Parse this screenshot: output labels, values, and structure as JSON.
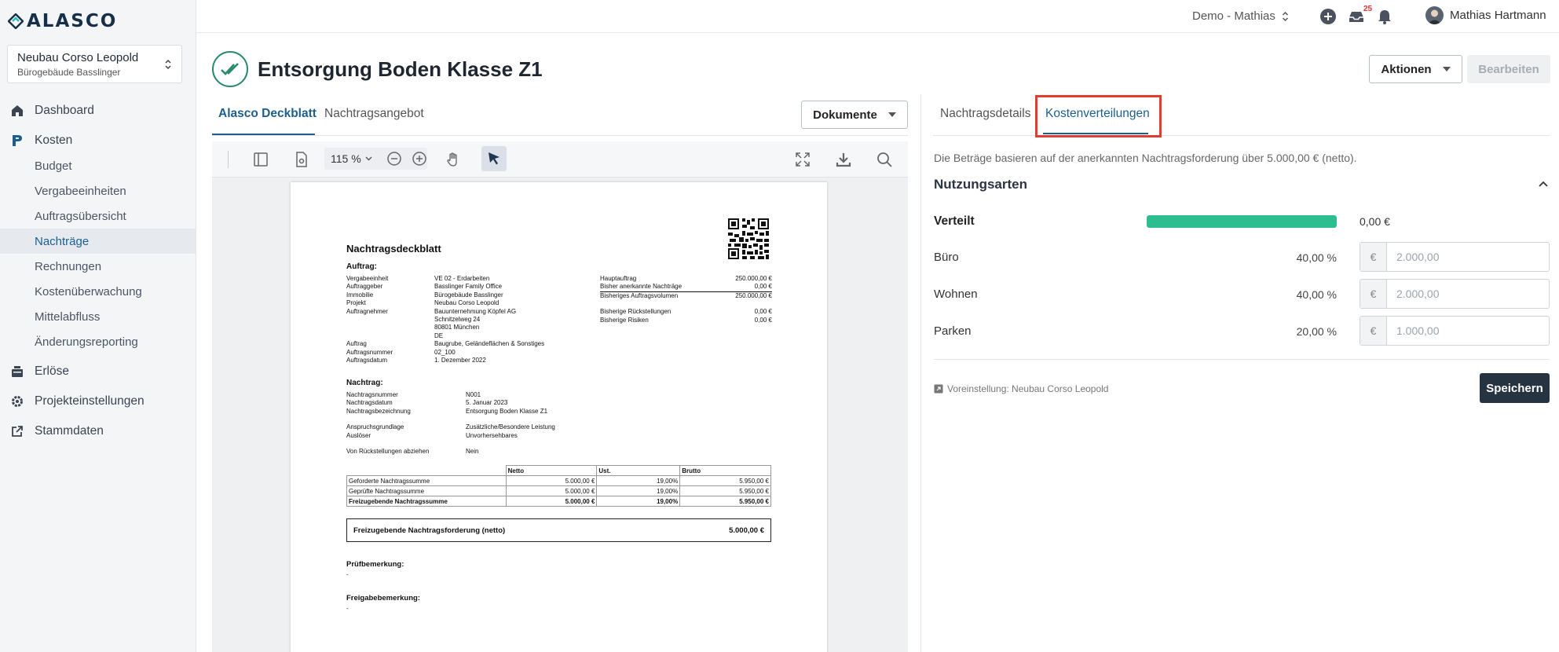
{
  "brand": {
    "name": "ALASCO"
  },
  "project": {
    "name": "Neubau Corso Leopold",
    "building": "Bürogebäude Basslinger"
  },
  "sidebar": {
    "items": [
      {
        "label": "Dashboard"
      },
      {
        "label": "Kosten"
      },
      {
        "label": "Budget"
      },
      {
        "label": "Vergabeeinheiten"
      },
      {
        "label": "Auftragsübersicht"
      },
      {
        "label": "Nachträge"
      },
      {
        "label": "Rechnungen"
      },
      {
        "label": "Kostenüberwachung"
      },
      {
        "label": "Mittelabfluss"
      },
      {
        "label": "Änderungsreporting"
      },
      {
        "label": "Erlöse"
      },
      {
        "label": "Projekteinstellungen"
      },
      {
        "label": "Stammdaten"
      }
    ]
  },
  "topbar": {
    "workspace": "Demo - Mathias",
    "inbox_count": "25",
    "user_name": "Mathias Hartmann"
  },
  "page": {
    "title": "Entsorgung Boden Klasse Z1",
    "actions_label": "Aktionen",
    "edit_label": "Bearbeiten"
  },
  "left_tabs": {
    "tab1": "Alasco Deckblatt",
    "tab2": "Nachtragsangebot",
    "documents_label": "Dokumente"
  },
  "pdf_toolbar": {
    "zoom": "115 %"
  },
  "doc": {
    "title": "Nachtragsdeckblatt",
    "auftrag_heading": "Auftrag:",
    "auftrag": [
      {
        "k": "Vergabeeinheit",
        "v": "VE 02 - Erdarbeiten"
      },
      {
        "k": "Auftraggeber",
        "v": "Basslinger Family Office"
      },
      {
        "k": "Immobilie",
        "v": "Bürogebäude Basslinger"
      },
      {
        "k": "Projekt",
        "v": "Neubau Corso Leopold"
      },
      {
        "k": "Auftragnehmer",
        "v": "Bauunternehmung Köpfel AG"
      },
      {
        "k": "",
        "v": "Schnitzelweg 24"
      },
      {
        "k": "",
        "v": "80801 München"
      },
      {
        "k": "",
        "v": "DE"
      },
      {
        "k": "Auftrag",
        "v": "Baugrube, Geländeflächen & Sonstiges"
      },
      {
        "k": "Auftragsnummer",
        "v": "02_100"
      },
      {
        "k": "Auftragsdatum",
        "v": "1. Dezember 2022"
      }
    ],
    "right_kv": [
      {
        "k": "Hauptauftrag",
        "v": "250.000,00 €"
      },
      {
        "k": "Bisher anerkannte Nachträge",
        "v": "0,00 €"
      },
      {
        "k": "Bisheriges Auftragsvolumen",
        "v": "250.000,00 €"
      },
      {
        "k": "Bisherige Rückstellungen",
        "v": "0,00 €"
      },
      {
        "k": "Bisherige Risiken",
        "v": "0,00 €"
      }
    ],
    "nachtrag_heading": "Nachtrag:",
    "nachtrag": [
      {
        "k": "Nachtragsnummer",
        "v": "N001"
      },
      {
        "k": "Nachtragsdatum",
        "v": "5. Januar 2023"
      },
      {
        "k": "Nachtragsbezeichnung",
        "v": "Entsorgung Boden Klasse Z1"
      },
      {
        "k": "Anspruchsgrundlage",
        "v": "Zusätzliche/Besondere Leistung"
      },
      {
        "k": "Auslöser",
        "v": "Unvorhersehbares"
      },
      {
        "k": "Von Rückstellungen abziehen",
        "v": "Nein"
      }
    ],
    "table": {
      "headers": [
        "Netto",
        "Ust.",
        "Brutto"
      ],
      "rows": [
        [
          "Geforderte Nachtragssumme",
          "5.000,00 €",
          "19,00%",
          "5.950,00 €"
        ],
        [
          "Geprüfte Nachtragssumme",
          "5.000,00 €",
          "19,00%",
          "5.950,00 €"
        ],
        [
          "Freizugebende Nachtragssumme",
          "5.000,00 €",
          "19,00%",
          "5.950,00 €"
        ]
      ]
    },
    "freigabe_label": "Freizugebende Nachtragsforderung (netto)",
    "freigabe_value": "5.000,00 €",
    "pruef_heading": "Prüfbemerkung:",
    "pruef_value": "-",
    "freig_heading": "Freigabebemerkung:",
    "freig_value": "-"
  },
  "right_tabs": {
    "tab1": "Nachtragsdetails",
    "tab2": "Kostenverteilungen"
  },
  "distribution": {
    "info": "Die Beträge basieren auf der anerkannten Nachtragsforderung über 5.000,00 € (netto).",
    "section_title": "Nutzungsarten",
    "verteilt_label": "Verteilt",
    "verteilt_value": "0,00 €",
    "verteilt_progress": 1.0,
    "currency": "€",
    "rows": [
      {
        "label": "Büro",
        "percent": "40,00 %",
        "placeholder": "2.000,00"
      },
      {
        "label": "Wohnen",
        "percent": "40,00 %",
        "placeholder": "2.000,00"
      },
      {
        "label": "Parken",
        "percent": "20,00 %",
        "placeholder": "1.000,00"
      }
    ],
    "preset": "Voreinstellung: Neubau Corso Leopold",
    "save_label": "Speichern"
  },
  "colors": {
    "accent": "#1d5e8c",
    "progress": "#2ebd8f",
    "highlight": "#e03c2f",
    "save_button": "#263341"
  }
}
